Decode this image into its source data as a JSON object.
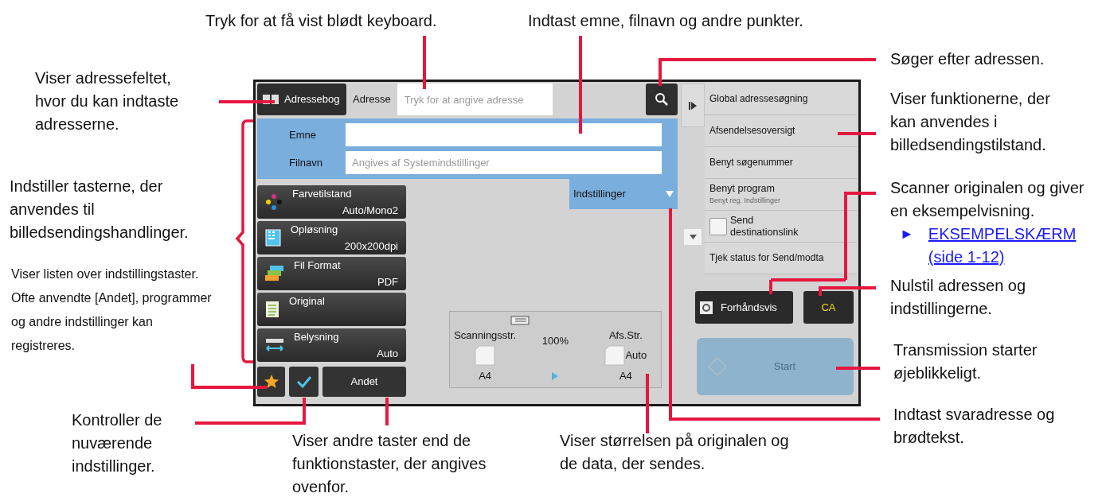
{
  "screen": {
    "address_book_button": "Adressebog",
    "address_label": "Adresse",
    "address_field": {
      "placeholder": "Tryk for at angive adresse"
    },
    "subject": {
      "label": "Emne"
    },
    "filename": {
      "label": "Filnavn",
      "placeholder": "Angives af Systemindstillinger"
    },
    "settings_tab": "Indstillinger",
    "function_keys": [
      {
        "label": "Farvetilstand",
        "value": "Auto/Mono2"
      },
      {
        "label": "Opløsning",
        "value": "200x200dpi"
      },
      {
        "label": "Fil Format",
        "value": "PDF"
      },
      {
        "label": "Original"
      },
      {
        "label": "Belysning",
        "value": "Auto"
      }
    ],
    "other_button": "Andet",
    "size_panel": {
      "scan_label": "Scanningsstr.",
      "ratio": "100%",
      "send_label": "Afs.Str.",
      "send_mode": "Auto",
      "scan_size": "A4",
      "send_size": "A4"
    },
    "side_menu": [
      {
        "kind": "plain",
        "label": "Global adressesøgning"
      },
      {
        "kind": "plain",
        "label": "Afsendelsesoversigt"
      },
      {
        "kind": "plain",
        "label": "Benyt søgenummer"
      },
      {
        "kind": "sub",
        "label": "Benyt program",
        "sublabel": "Benyt reg. Indstillinger"
      },
      {
        "kind": "checkbox",
        "label": "Send destinationslink",
        "checked": false
      },
      {
        "kind": "plain",
        "label": "Tjek status for Send/modta"
      }
    ],
    "preview_button": "Forhåndsvis",
    "ca_button": "CA",
    "start_button": {
      "label": "Start",
      "disabled": true
    }
  },
  "callouts": [
    {
      "text": "Tryk for at få vist blødt keyboard."
    },
    {
      "text": "Indtast emne, filnavn og andre punkter."
    },
    {
      "text": "Søger efter adressen."
    },
    {
      "text": "Viser adressefeltet, hvor du kan indtaste adresserne."
    },
    {
      "text": "Viser funktionerne, der kan anvendes i billedsendingstilstand."
    },
    {
      "text": "Indstiller tasterne, der anvendes til billedsendingshandlinger."
    },
    {
      "text": "Viser listen over indstillingstaster. Ofte anvendte [Andet], programmer og andre indstillinger kan registreres."
    },
    {
      "text": "Scanner originalen og giver en eksempelvisning.",
      "link_arrow": "►",
      "link": "EKSEMPELSKÆRM (side 1-12)"
    },
    {
      "text": "Nulstil adressen og indstillingerne."
    },
    {
      "text": "Transmission starter øjeblikkeligt."
    },
    {
      "text": "Kontroller de nuværende indstillinger."
    },
    {
      "text": "Viser andre taster end de funktionstaster, der angives ovenfor."
    },
    {
      "text": "Viser størrelsen på originalen og de data, der sendes."
    },
    {
      "text": "Indtast svaradresse og brødtekst."
    }
  ]
}
